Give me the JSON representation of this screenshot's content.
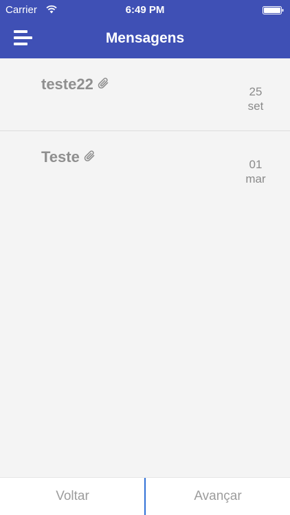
{
  "status_bar": {
    "carrier": "Carrier",
    "time": "6:49 PM",
    "wifi_icon": "wifi-icon",
    "battery_icon": "battery-icon"
  },
  "header": {
    "title": "Mensagens",
    "menu_icon": "menu-icon",
    "background_color": "#3f50b5"
  },
  "messages": [
    {
      "subject": "teste22",
      "attachment_icon": "paperclip-icon",
      "day": "25",
      "month": "set"
    },
    {
      "subject": "Teste",
      "attachment_icon": "paperclip-icon",
      "day": "01",
      "month": "mar"
    }
  ],
  "footer": {
    "back_label": "Voltar",
    "next_label": "Avançar",
    "divider_color": "#2f6fd6"
  }
}
